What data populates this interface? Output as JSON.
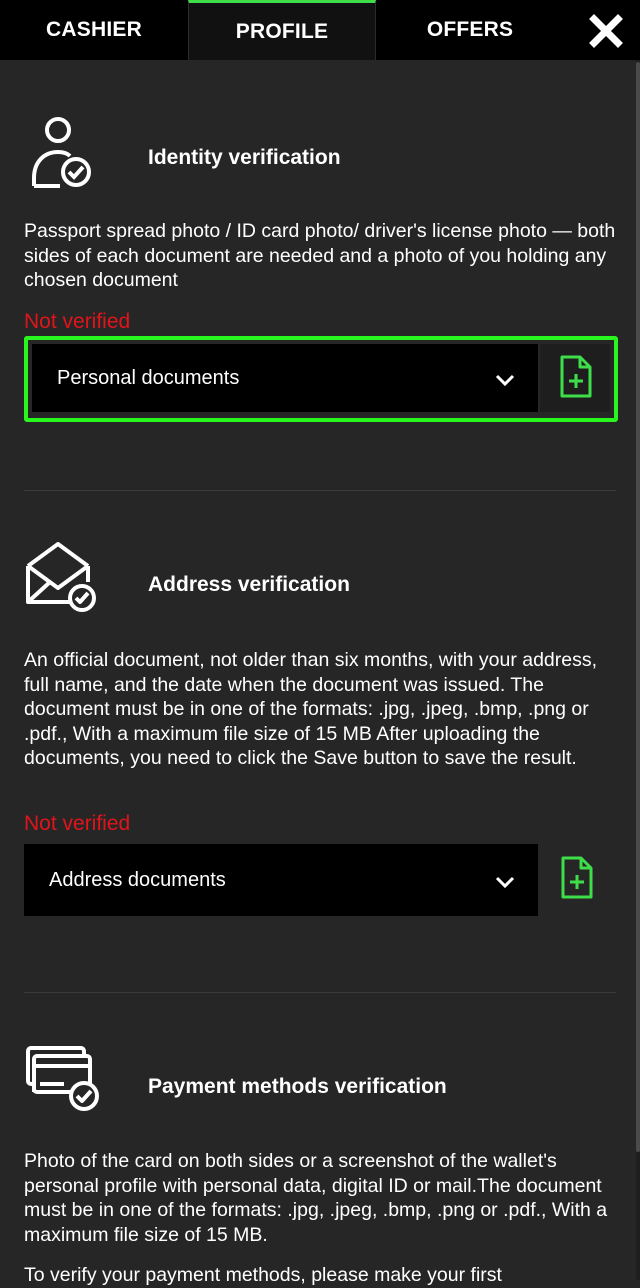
{
  "tabs": [
    {
      "label": "CASHIER"
    },
    {
      "label": "PROFILE"
    },
    {
      "label": "OFFERS"
    }
  ],
  "sections": {
    "identity": {
      "title": "Identity verification",
      "description": "Passport spread photo / ID card photo/ driver's license photo — both sides of each document are needed and a photo of you holding any chosen document",
      "status": "Not verified",
      "select_value": "Personal documents"
    },
    "address": {
      "title": "Address verification",
      "description": "An official document, not older than six months, with your address, full name, and the date when the document was issued. The document must be in one of the formats: .jpg, .jpeg, .bmp, .png or .pdf., With a maximum file size of 15 MB After uploading the documents, you need to click the Save button to save the result.",
      "status": "Not verified",
      "select_value": "Address documents"
    },
    "payment": {
      "title": "Payment methods verification",
      "description": "Photo of the card on both sides or a screenshot of the wallet's personal profile with personal data, digital ID or mail.The document must be in one of the formats: .jpg, .jpeg, .bmp, .png or .pdf., With a maximum file size of 15 MB.",
      "note": "To verify your payment methods, please make your first"
    }
  },
  "colors": {
    "accent": "#3dde4a",
    "highlight": "#29f51f",
    "status": "#e0151b",
    "background": "#262626"
  },
  "icons": [
    "close-icon",
    "user-check-icon",
    "chevron-down-icon",
    "file-plus-icon",
    "envelope-check-icon",
    "cards-check-icon"
  ]
}
